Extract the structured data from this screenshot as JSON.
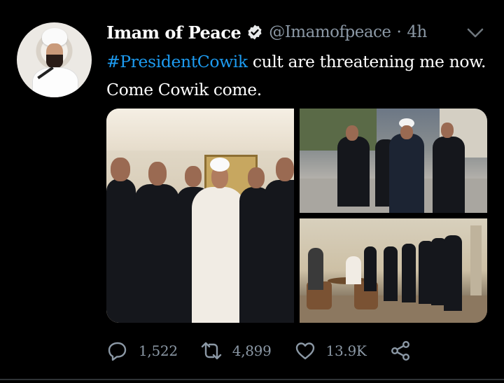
{
  "tweet": {
    "author_name": "Imam of Peace",
    "handle": "@Imamofpeace",
    "separator": "·",
    "time": "4h",
    "text_hashtag": "#PresidentCowik",
    "text_rest_line1": " cult are threatening me now.",
    "text_line2": "Come Cowik come."
  },
  "icons": {
    "verified": "verified-badge-icon",
    "more": "chevron-down-icon",
    "reply": "reply-icon",
    "retweet": "retweet-icon",
    "like": "heart-icon",
    "share": "share-icon"
  },
  "stats": {
    "replies": "1,522",
    "retweets": "4,899",
    "likes": "13.9K"
  },
  "colors": {
    "background": "#000000",
    "link": "#1d9bf0",
    "secondary_text": "#8b98a5"
  }
}
